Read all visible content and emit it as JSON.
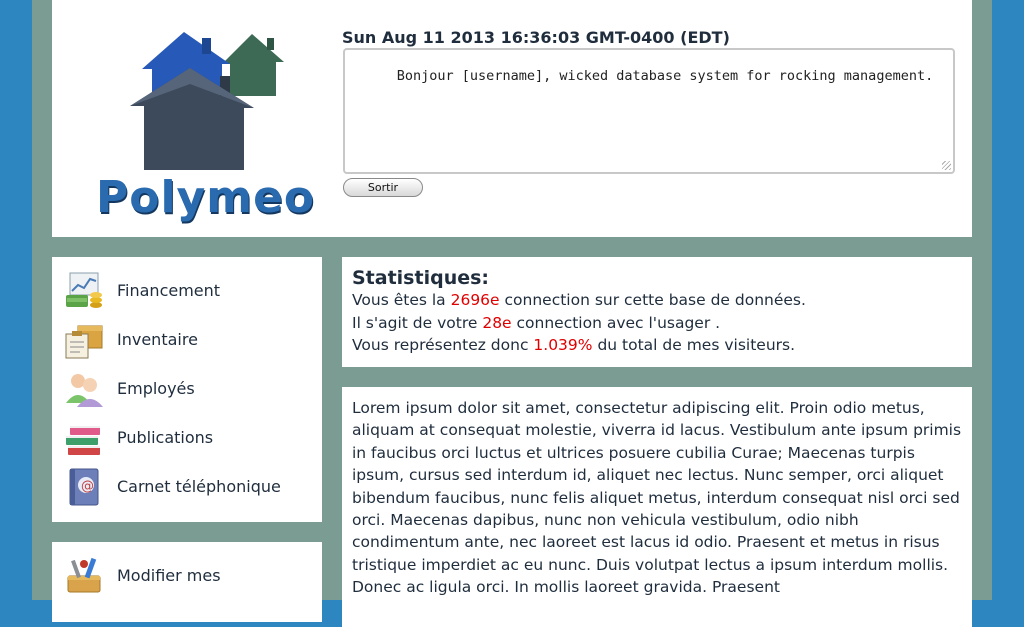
{
  "header": {
    "logo_text": "Polymeo",
    "datetime": "Sun Aug 11 2013 16:36:03 GMT-0400 (EDT)",
    "message": "Bonjour [username], wicked database system for rocking management.",
    "logout_label": "Sortir"
  },
  "sidebar": {
    "items": [
      {
        "label": "Financement",
        "icon": "finance-icon"
      },
      {
        "label": "Inventaire",
        "icon": "inventory-icon"
      },
      {
        "label": "Employés",
        "icon": "employees-icon"
      },
      {
        "label": "Publications",
        "icon": "books-icon"
      },
      {
        "label": "Carnet téléphonique",
        "icon": "addressbook-icon"
      }
    ],
    "secondary": [
      {
        "label": "Modifier mes",
        "icon": "tools-icon"
      }
    ]
  },
  "stats": {
    "title": "Statistiques:",
    "line1_pre": "Vous êtes la ",
    "line1_val": "2696e",
    "line1_post": " connection sur cette base de données.",
    "line2_pre": "Il s'agit de votre ",
    "line2_val": "28e",
    "line2_post": " connection avec l'usager .",
    "line3_pre": "Vous représentez donc ",
    "line3_val": "1.039%",
    "line3_post": " du total de mes visiteurs."
  },
  "content": {
    "text": "Lorem ipsum dolor sit amet, consectetur adipiscing elit. Proin odio metus, aliquam at consequat molestie, viverra id lacus. Vestibulum ante ipsum primis in faucibus orci luctus et ultrices posuere cubilia Curae; Maecenas turpis ipsum, cursus sed interdum id, aliquet nec lectus. Nunc semper, orci aliquet bibendum faucibus, nunc felis aliquet metus, interdum consequat nisl orci sed orci. Maecenas dapibus, nunc non vehicula vestibulum, odio nibh condimentum ante, nec laoreet est lacus id odio. Praesent et metus in risus tristique imperdiet ac eu nunc. Duis volutpat lectus a ipsum interdum mollis. Donec ac ligula orci. In mollis laoreet gravida. Praesent"
  },
  "colors": {
    "page_bg": "#2e86c1",
    "frame_bg": "#7a9c92",
    "highlight": "#e00000"
  }
}
